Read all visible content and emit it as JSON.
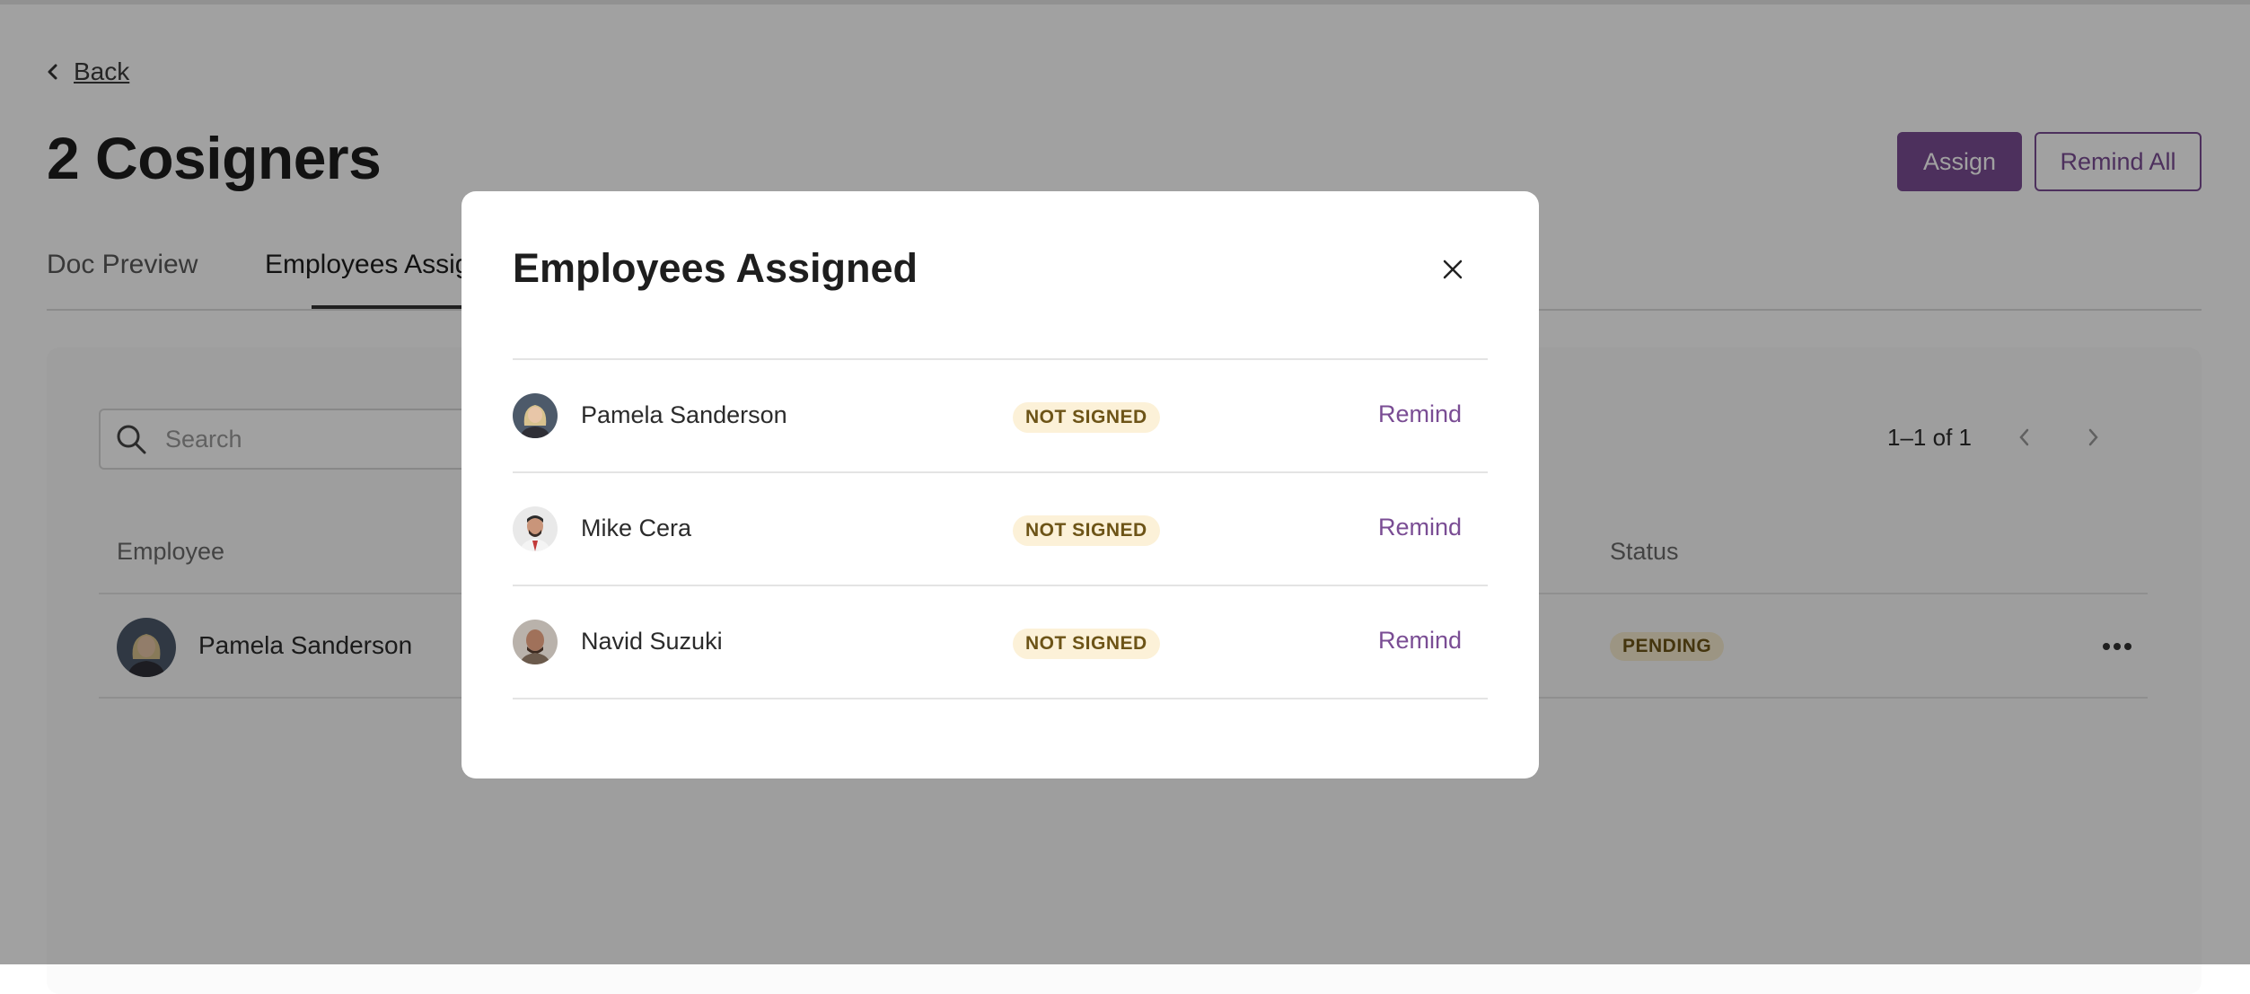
{
  "header": {
    "back_label": "Back",
    "title": "2 Cosigners",
    "assign_label": "Assign",
    "remind_all_label": "Remind All"
  },
  "tabs": [
    {
      "label": "Doc Preview"
    },
    {
      "label": "Employees Assigned"
    }
  ],
  "table": {
    "search_placeholder": "Search",
    "pagination": "1–1 of 1",
    "columns": {
      "employee": "Employee",
      "status": "Status"
    },
    "rows": [
      {
        "name": "Pamela Sanderson",
        "status": "PENDING"
      }
    ]
  },
  "modal": {
    "title": "Employees Assigned",
    "employees": [
      {
        "name": "Pamela Sanderson",
        "status": "NOT SIGNED",
        "action": "Remind"
      },
      {
        "name": "Mike Cera",
        "status": "NOT SIGNED",
        "action": "Remind"
      },
      {
        "name": "Navid Suzuki",
        "status": "NOT SIGNED",
        "action": "Remind"
      }
    ]
  },
  "colors": {
    "accent": "#7a4d94",
    "badge_bg": "#fcf1d8",
    "badge_text": "#6d5417",
    "overlay": "rgba(0,0,0,0.37)"
  },
  "icons": {
    "back": "chevron-left-icon",
    "search": "search-icon",
    "prev_page": "chevron-left-icon",
    "next_page": "chevron-right-icon",
    "more": "more-horizontal-icon",
    "close": "close-icon"
  }
}
